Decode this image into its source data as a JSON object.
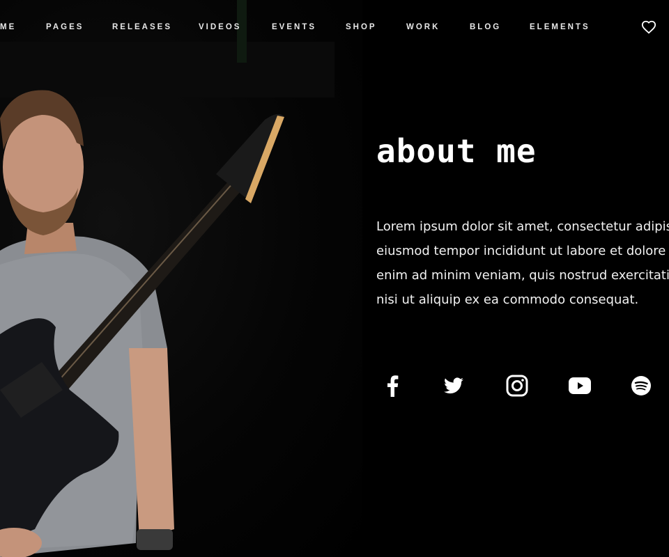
{
  "nav": {
    "items": [
      {
        "label": "ME"
      },
      {
        "label": "PAGES"
      },
      {
        "label": "RELEASES"
      },
      {
        "label": "VIDEOS"
      },
      {
        "label": "EVENTS"
      },
      {
        "label": "SHOP"
      },
      {
        "label": "WORK"
      },
      {
        "label": "BLOG"
      },
      {
        "label": "ELEMENTS"
      }
    ],
    "wishlist_icon": "heart-icon"
  },
  "hero": {
    "image_alt": "Musician holding an electric guitar"
  },
  "about": {
    "title": "about me",
    "lines": [
      "Lorem ipsum dolor sit amet, consectetur adipisci",
      "eiusmod tempor incididunt ut labore et dolore m",
      "enim ad minim veniam, quis nostrud exercitation",
      "nisi ut aliquip ex ea commodo consequat."
    ]
  },
  "social": [
    {
      "icon": "facebook-icon"
    },
    {
      "icon": "twitter-icon"
    },
    {
      "icon": "instagram-icon"
    },
    {
      "icon": "youtube-icon"
    },
    {
      "icon": "spotify-icon"
    }
  ],
  "colors": {
    "background": "#000000",
    "text": "#ffffff",
    "nav_text": "#e8e8e8"
  }
}
